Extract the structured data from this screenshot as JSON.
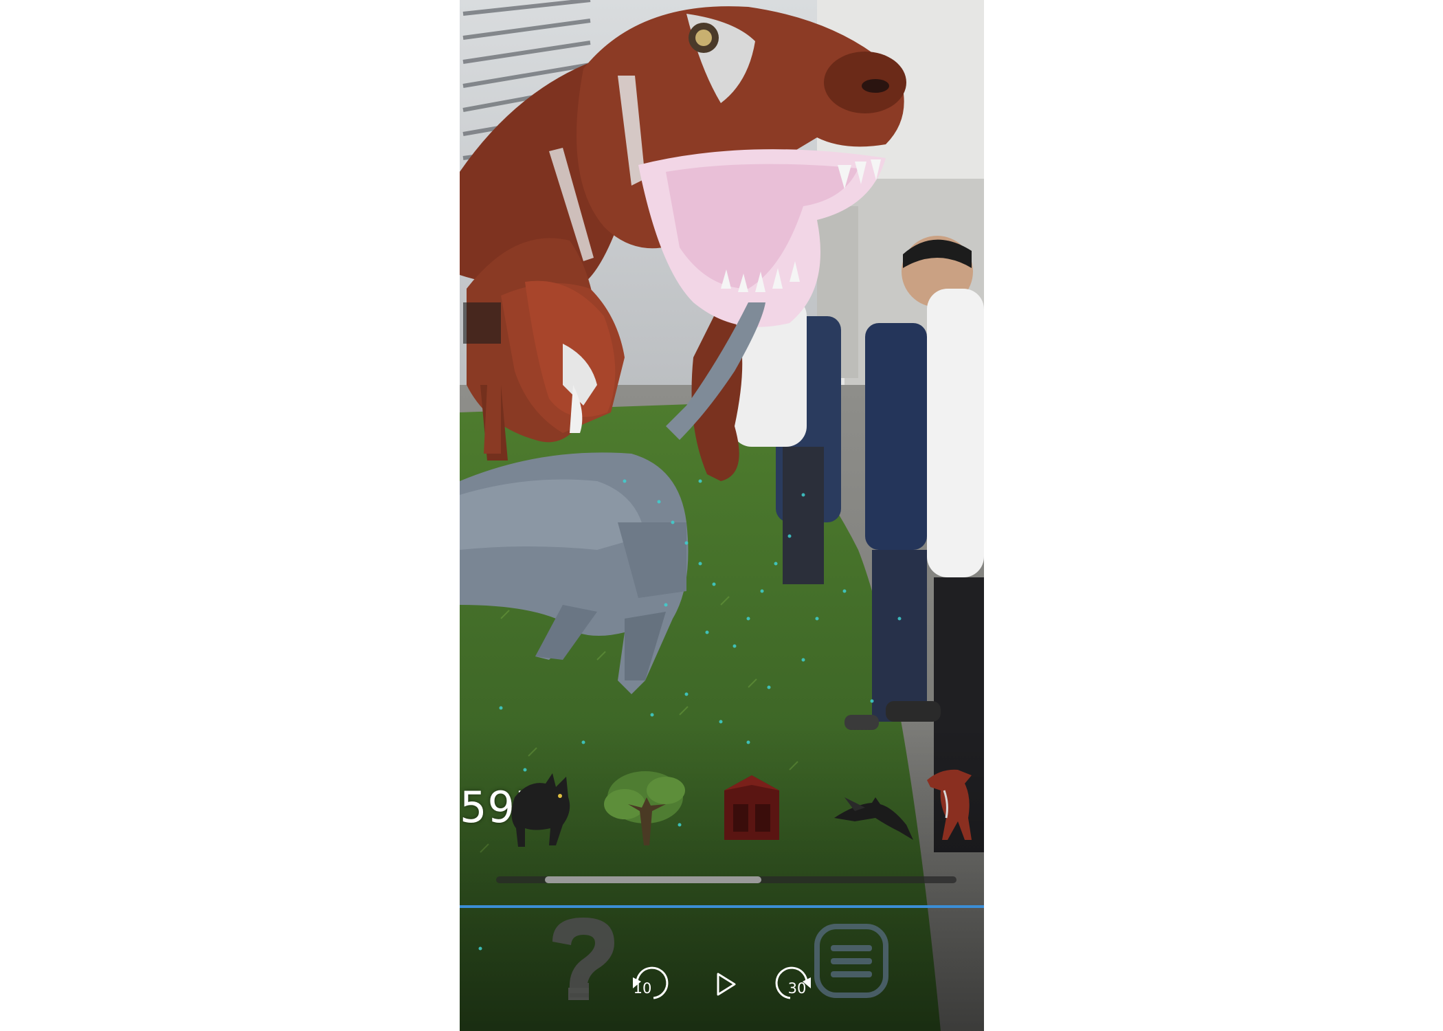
{
  "hud": {
    "score": "597"
  },
  "object_palette": {
    "items": [
      {
        "name": "cat",
        "icon": "cat-icon"
      },
      {
        "name": "tree",
        "icon": "tree-icon"
      },
      {
        "name": "barn",
        "icon": "barn-icon"
      },
      {
        "name": "pterodactyl",
        "icon": "pterodactyl-icon"
      },
      {
        "name": "dinosaur",
        "icon": "dinosaur-icon"
      }
    ],
    "scroll_position": 0.2,
    "scroll_visible_fraction": 0.47
  },
  "controls": {
    "help_icon": "question-mark-icon",
    "rewind": {
      "icon": "rewind-icon",
      "label": "10"
    },
    "play": {
      "icon": "play-icon"
    },
    "forward": {
      "icon": "fast-forward-icon",
      "label": "30"
    },
    "menu_icon": "menu-icon"
  },
  "colors": {
    "accent": "#3b8ed6",
    "grass": "#3d6b2a",
    "trex_body": "#8a3a24",
    "cat_body": "#7a8694",
    "text": "#ffffff"
  }
}
